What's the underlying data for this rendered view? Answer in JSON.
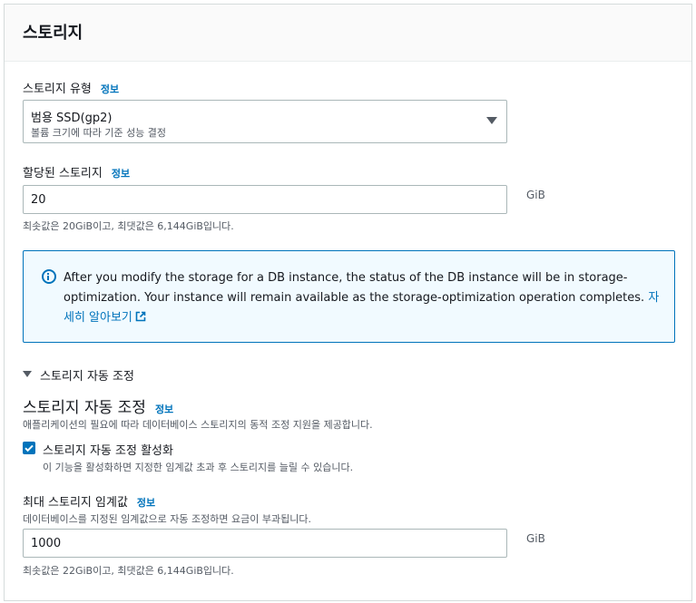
{
  "header": {
    "title": "스토리지"
  },
  "storage_type": {
    "label": "스토리지 유형",
    "info": "정보",
    "selected_main": "범용 SSD(gp2)",
    "selected_sub": "볼륨 크기에 따라 기준 성능 결정"
  },
  "allocated": {
    "label": "할당된 스토리지",
    "info": "정보",
    "value": "20",
    "unit": "GiB",
    "hint": "최솟값은 20GiB이고, 최댓값은 6,144GiB입니다."
  },
  "alert": {
    "text": "After you modify the storage for a DB instance, the status of the DB instance will be in storage-optimization. Your instance will remain available as the storage-optimization operation completes.",
    "link_label": "자세히 알아보기"
  },
  "autoscaling": {
    "expander_label": "스토리지 자동 조정",
    "title": "스토리지 자동 조정",
    "info": "정보",
    "description": "애플리케이션의 필요에 따라 데이터베이스 스토리지의 동적 조정 지원을 제공합니다.",
    "checkbox_label": "스토리지 자동 조정 활성화",
    "checkbox_checked": true,
    "checkbox_hint": "이 기능을 활성화하면 지정한 임계값 초과 후 스토리지를 늘릴 수 있습니다."
  },
  "max_threshold": {
    "label": "최대 스토리지 임계값",
    "info": "정보",
    "description": "데이터베이스를 지정된 임계값으로 자동 조정하면 요금이 부과됩니다.",
    "value": "1000",
    "unit": "GiB",
    "hint": "최솟값은 22GiB이고, 최댓값은 6,144GiB입니다."
  },
  "colors": {
    "accent": "#0073bb",
    "alert_background": "#f1faff",
    "border": "#aab7b8",
    "header_background": "#fafafa"
  },
  "icons": [
    "info-icon",
    "external-link-icon",
    "caret-down-icon",
    "checkmark-icon"
  ]
}
